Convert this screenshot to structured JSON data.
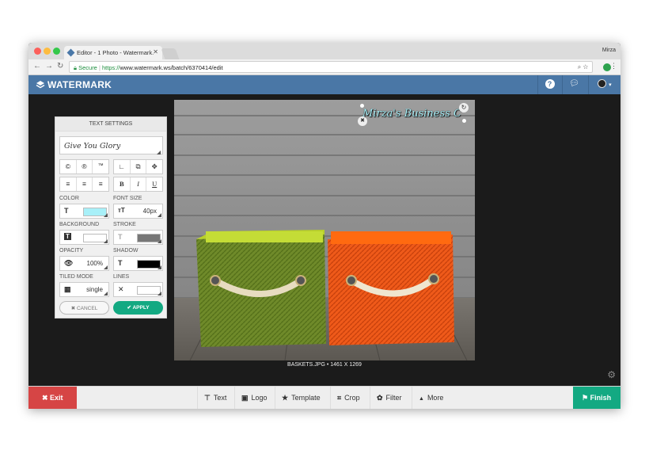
{
  "browser": {
    "tab_title": "Editor - 1 Photo - Watermark.",
    "tab_close": "✕",
    "user_name": "Mirza",
    "secure_label": "Secure",
    "url_scheme": "https://",
    "url_rest": "www.watermark.ws/batch/6370414/edit"
  },
  "app": {
    "brand": "WATERMARK"
  },
  "text_settings": {
    "title": "TEXT SETTINGS",
    "text_value": "Give You Glory",
    "symbols": [
      "©",
      "®",
      "™"
    ],
    "align": [
      "≡",
      "≡",
      "≡"
    ],
    "styles": [
      "B",
      "I",
      "U"
    ],
    "color_label": "COLOR",
    "color_value": "#a8f0f8",
    "font_size_label": "FONT SIZE",
    "font_size": "40px",
    "background_label": "BACKGROUND",
    "background_value": "#ffffff",
    "stroke_label": "STROKE",
    "stroke_value": "#777777",
    "opacity_label": "OPACITY",
    "opacity": "100%",
    "shadow_label": "SHADOW",
    "shadow_value": "#000000",
    "tiled_label": "TILED MODE",
    "tiled_value": "single",
    "lines_label": "LINES",
    "cancel_label": "✖ CANCEL",
    "apply_label": "✔ APPLY"
  },
  "photo": {
    "watermark_text": "Mirza's Business C",
    "caption": "BASKETS.JPG • 1461 X 1269"
  },
  "toolbar": {
    "exit_label": "✖  Exit",
    "finish_label": "⚑  Finish",
    "tools": [
      {
        "icon": "⊤",
        "label": "Text"
      },
      {
        "icon": "▣",
        "label": "Logo"
      },
      {
        "icon": "★",
        "label": "Template"
      },
      {
        "icon": "⌗",
        "label": "Crop"
      },
      {
        "icon": "✿",
        "label": "Filter"
      },
      {
        "icon": "▲",
        "label": "More"
      }
    ]
  },
  "colors": {
    "accent_blue": "#4a77a6",
    "exit_red": "#d64545",
    "finish_green": "#13a982"
  }
}
